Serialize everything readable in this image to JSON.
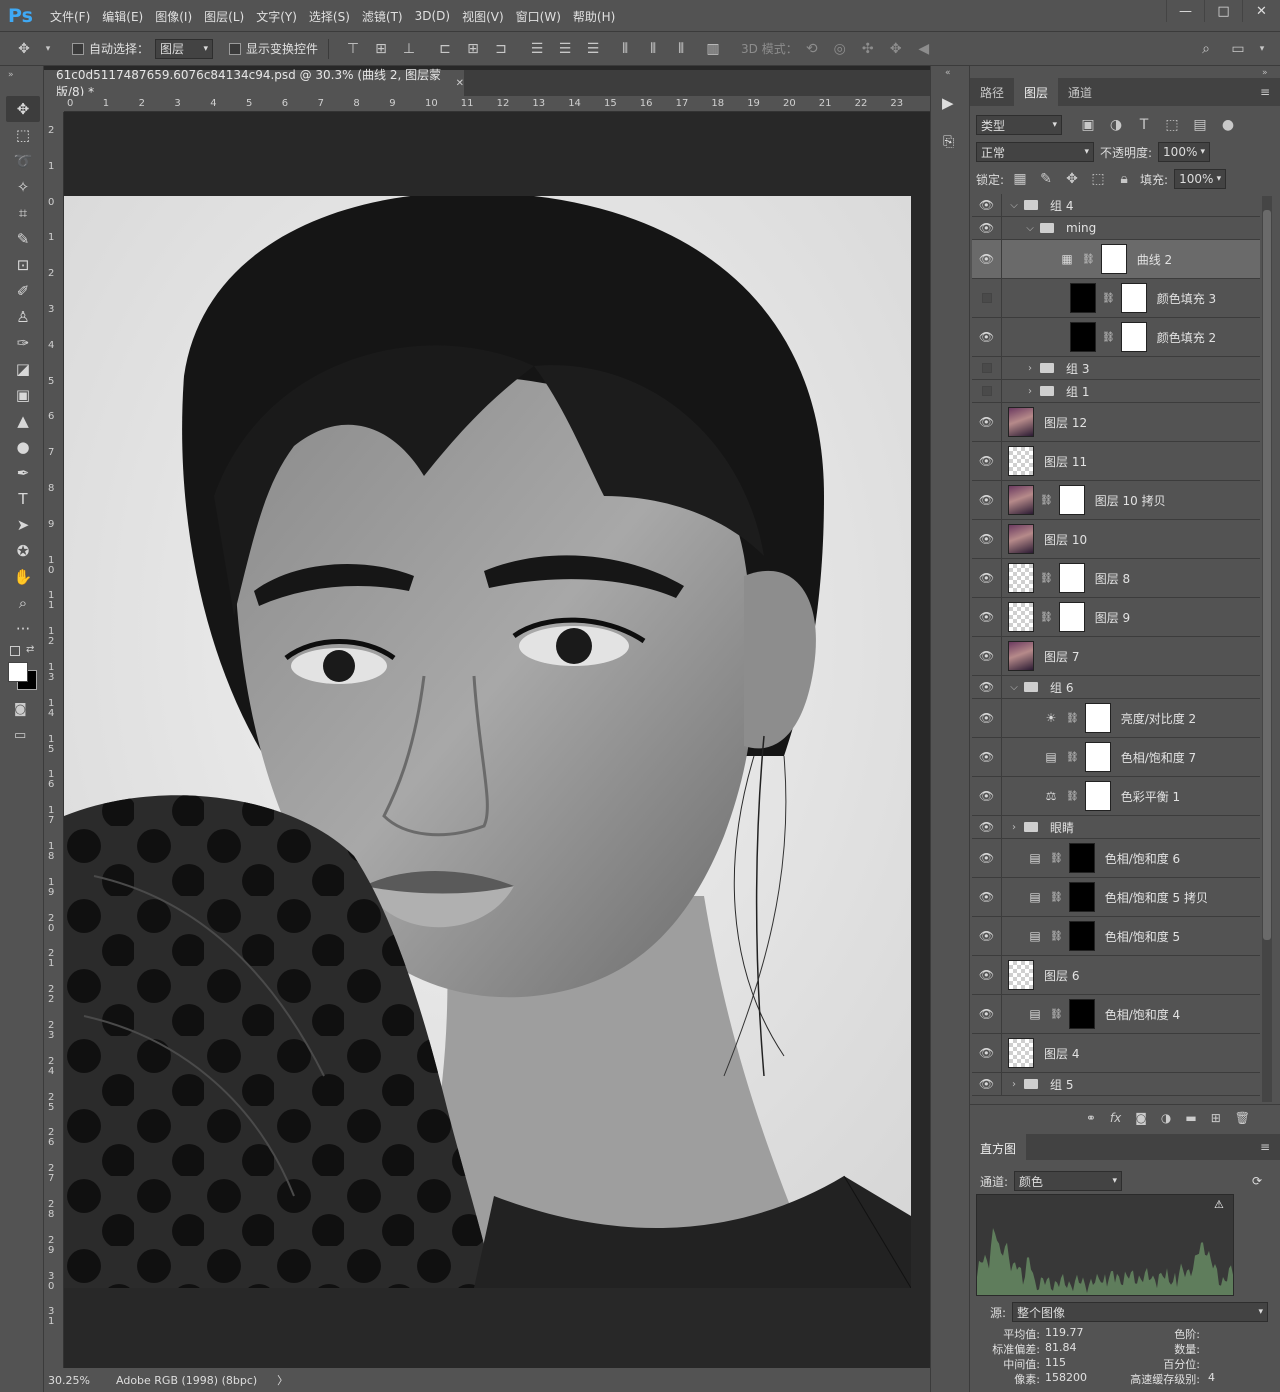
{
  "app": {
    "logo": "Ps"
  },
  "menu": [
    "文件(F)",
    "编辑(E)",
    "图像(I)",
    "图层(L)",
    "文字(Y)",
    "选择(S)",
    "滤镜(T)",
    "3D(D)",
    "视图(V)",
    "窗口(W)",
    "帮助(H)"
  ],
  "window_controls": [
    "—",
    "□",
    "✕"
  ],
  "options": {
    "auto_select_label": "自动选择：",
    "auto_select_value": "图层",
    "show_transform_label": "显示变换控件",
    "mode_3d_label": "3D 模式："
  },
  "document": {
    "tab_title": "61c0d5117487659.6076c84134c94.psd @ 30.3% (曲线 2, 图层蒙版/8) *",
    "close": "✕",
    "zoom": "30.25%",
    "profile": "Adobe RGB (1998) (8bpc)",
    "status_arrow": "〉",
    "ruler_h": [
      "0",
      "1",
      "2",
      "3",
      "4",
      "5",
      "6",
      "7",
      "8",
      "9",
      "10",
      "11",
      "12",
      "13",
      "14",
      "15",
      "16",
      "17",
      "18",
      "19",
      "20",
      "21",
      "22",
      "23"
    ],
    "ruler_v": [
      "2",
      "1",
      "0",
      "1",
      "2",
      "3",
      "4",
      "5",
      "6",
      "7",
      "8",
      "9",
      "1 0",
      "1 1",
      "1 2",
      "1 3",
      "1 4",
      "1 5",
      "1 6",
      "1 7",
      "1 8",
      "1 9",
      "2 0",
      "2 1",
      "2 2",
      "2 3",
      "2 4",
      "2 5",
      "2 6",
      "2 7",
      "2 8",
      "2 9",
      "3 0",
      "3 1"
    ]
  },
  "panel_tabs": [
    "路径",
    "图层",
    "通道"
  ],
  "layers_panel": {
    "filter_label": "类型",
    "blend_mode": "正常",
    "opacity_label": "不透明度:",
    "opacity_value": "100%",
    "lock_label": "锁定:",
    "fill_label": "填充:",
    "fill_value": "100%"
  },
  "layers": [
    {
      "name": "组 4",
      "kind": "group",
      "visible": true,
      "indent": 0,
      "expanded": true
    },
    {
      "name": "ming",
      "kind": "group",
      "visible": true,
      "indent": 1,
      "expanded": true
    },
    {
      "name": "曲线 2",
      "kind": "adjust",
      "icon": "curves-icon",
      "glyph": "▦",
      "visible": true,
      "indent": 2,
      "mask": "white",
      "selected": true
    },
    {
      "name": "颜色填充 3",
      "kind": "fill",
      "visible": false,
      "indent": 2,
      "mask": "white"
    },
    {
      "name": "颜色填充 2",
      "kind": "fill",
      "visible": true,
      "indent": 2,
      "mask": "white"
    },
    {
      "name": "组 3",
      "kind": "group",
      "visible": false,
      "indent": 1,
      "expanded": false
    },
    {
      "name": "组 1",
      "kind": "group",
      "visible": false,
      "indent": 1,
      "expanded": false
    },
    {
      "name": "图层 12",
      "kind": "photo",
      "visible": true,
      "indent": 0
    },
    {
      "name": "图层 11",
      "kind": "checker",
      "visible": true,
      "indent": 0
    },
    {
      "name": "图层 10 拷贝",
      "kind": "photo",
      "visible": true,
      "indent": 0,
      "mask": "white"
    },
    {
      "name": "图层 10",
      "kind": "photo",
      "visible": true,
      "indent": 0
    },
    {
      "name": "图层 8",
      "kind": "checker",
      "visible": true,
      "indent": 0,
      "mask": "white"
    },
    {
      "name": "图层 9",
      "kind": "checker",
      "visible": true,
      "indent": 0,
      "mask": "white"
    },
    {
      "name": "图层 7",
      "kind": "photo",
      "visible": true,
      "indent": 0
    },
    {
      "name": "组 6",
      "kind": "group",
      "visible": true,
      "indent": 0,
      "expanded": true
    },
    {
      "name": "亮度/对比度 2",
      "kind": "adjust",
      "icon": "brightness-icon",
      "glyph": "☀",
      "visible": true,
      "indent": 1,
      "mask": "white"
    },
    {
      "name": "色相/饱和度 7",
      "kind": "adjust",
      "icon": "hue-saturation-icon",
      "glyph": "▤",
      "visible": true,
      "indent": 1,
      "mask": "white"
    },
    {
      "name": "色彩平衡 1",
      "kind": "adjust",
      "icon": "color-balance-icon",
      "glyph": "⚖",
      "visible": true,
      "indent": 1,
      "mask": "white"
    },
    {
      "name": "眼睛",
      "kind": "group",
      "visible": true,
      "indent": 0,
      "expanded": false
    },
    {
      "name": "色相/饱和度 6",
      "kind": "adjust",
      "icon": "hue-saturation-icon",
      "glyph": "▤",
      "visible": true,
      "indent": 0,
      "mask": "black"
    },
    {
      "name": "色相/饱和度 5 拷贝",
      "kind": "adjust",
      "icon": "hue-saturation-icon",
      "glyph": "▤",
      "visible": true,
      "indent": 0,
      "mask": "black"
    },
    {
      "name": "色相/饱和度 5",
      "kind": "adjust",
      "icon": "hue-saturation-icon",
      "glyph": "▤",
      "visible": true,
      "indent": 0,
      "mask": "black"
    },
    {
      "name": "图层 6",
      "kind": "checker",
      "visible": true,
      "indent": 0
    },
    {
      "name": "色相/饱和度 4",
      "kind": "adjust",
      "icon": "hue-saturation-icon",
      "glyph": "▤",
      "visible": true,
      "indent": 0,
      "mask": "black"
    },
    {
      "name": "图层 4",
      "kind": "checker",
      "visible": true,
      "indent": 0
    },
    {
      "name": "组 5",
      "kind": "group",
      "visible": true,
      "indent": 0,
      "expanded": false
    }
  ],
  "histogram": {
    "tab": "直方图",
    "channel_label": "通道:",
    "channel_value": "颜色",
    "source_label": "源:",
    "source_value": "整个图像",
    "stats": [
      {
        "label": "平均值:",
        "value": "119.77"
      },
      {
        "label": "标准偏差:",
        "value": "81.84"
      },
      {
        "label": "中间值:",
        "value": "115"
      },
      {
        "label": "像素:",
        "value": "158200"
      }
    ],
    "stats_right": [
      {
        "label": "色阶:",
        "value": ""
      },
      {
        "label": "数量:",
        "value": ""
      },
      {
        "label": "百分位:",
        "value": ""
      },
      {
        "label": "高速缓存级别:",
        "value": "4"
      }
    ]
  }
}
